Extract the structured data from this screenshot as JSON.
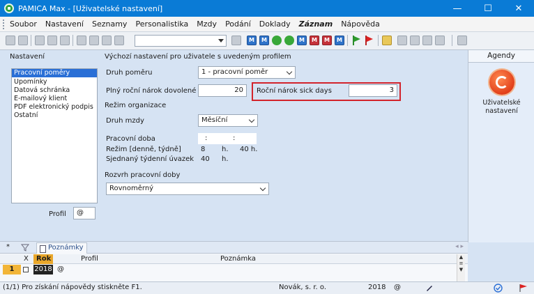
{
  "window": {
    "title": "PAMICA Max - [Uživatelské nastavení]",
    "min": "—",
    "max": "☐",
    "close": "✕"
  },
  "menu": [
    "Soubor",
    "Nastavení",
    "Seznamy",
    "Personalistika",
    "Mzdy",
    "Podání",
    "Doklady",
    "Záznam",
    "Nápověda"
  ],
  "toolbar": {
    "badge_m": "M",
    "badge_h": "M"
  },
  "nav": {
    "caption": "Nastavení",
    "items": [
      "Pracovní poměry",
      "Upomínky",
      "Datová schránka",
      "E-mailový klient",
      "PDF elektronický podpis",
      "Ostatní"
    ],
    "profil_label": "Profil",
    "profil_value": "@"
  },
  "form": {
    "section_title": "Výchozí nastavení pro uživatele s uvedeným profilem",
    "druh_pomeru_label": "Druh poměru",
    "druh_pomeru_value": "1 - pracovní poměr",
    "plny_narok_label": "Plný roční nárok dovolené",
    "plny_narok_value": "20",
    "sick_days_label": "Roční nárok sick days",
    "sick_days_value": "3",
    "rezim_label": "Režim organizace",
    "druh_mzdy_label": "Druh mzdy",
    "druh_mzdy_value": "Měsíční",
    "pracovni_doba_label": "Pracovní doba",
    "time_sep1": ":",
    "time_sep2": ":",
    "rezim_denne_label": "Režim [denně, týdně]",
    "rezim_denne_value": "8",
    "rezim_denne_unit": "h.",
    "rezim_tydne_value": "40 h.",
    "sjednany_label": "Sjednaný týdenní úvazek",
    "sjednany_value": "40",
    "sjednany_unit": "h.",
    "rozvrh_label": "Rozvrh pracovní doby",
    "rozvrh_value": "Rovnoměrný"
  },
  "agendy": {
    "header": "Agendy",
    "item_label": "Uživatelské nastavení"
  },
  "bottom": {
    "star": "*",
    "tab_label": "Poznámky",
    "nav_arrows": "◂ ▸",
    "columns": {
      "x": "X",
      "rok": "Rok",
      "profil": "Profil",
      "poznamka": "Poznámka"
    },
    "rows": [
      {
        "num": "1",
        "rok": "2018",
        "profil": "@"
      }
    ]
  },
  "status": {
    "help": "(1/1) Pro získání nápovědy stiskněte F1.",
    "company": "Novák, s. r. o.",
    "year": "2018",
    "at": "@"
  }
}
